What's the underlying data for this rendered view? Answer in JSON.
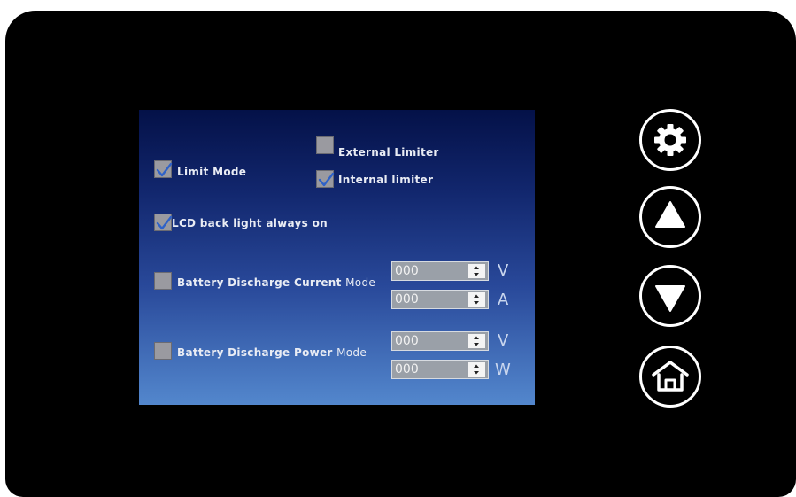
{
  "checkboxes": {
    "limit_mode": {
      "label": "Limit Mode",
      "checked": true
    },
    "external_limiter": {
      "label": "External Limiter",
      "checked": false
    },
    "internal_limiter": {
      "label": "Internal limiter",
      "checked": true
    },
    "lcd_backlight": {
      "label": "LCD back light always on",
      "checked": true
    },
    "battery_current": {
      "label_main": "Battery  Discharge Current",
      "label_mode": "Mode",
      "checked": false
    },
    "battery_power": {
      "label_main": "Battery  Discharge Power",
      "label_mode": "Mode",
      "checked": false
    }
  },
  "spinners": {
    "current_v": {
      "value": "000",
      "unit": "V"
    },
    "current_a": {
      "value": "000",
      "unit": "A"
    },
    "power_v": {
      "value": "000",
      "unit": "V"
    },
    "power_w": {
      "value": "000",
      "unit": "W"
    }
  },
  "buttons": {
    "settings": {
      "icon": "gear-icon"
    },
    "up": {
      "icon": "triangle-up-icon"
    },
    "down": {
      "icon": "triangle-down-icon"
    },
    "home": {
      "icon": "home-icon"
    }
  },
  "colors": {
    "screen_top": "#041148",
    "screen_bottom": "#5387cd",
    "check_mark": "#2f62c8",
    "checkbox_fill": "#9a9aa0"
  }
}
